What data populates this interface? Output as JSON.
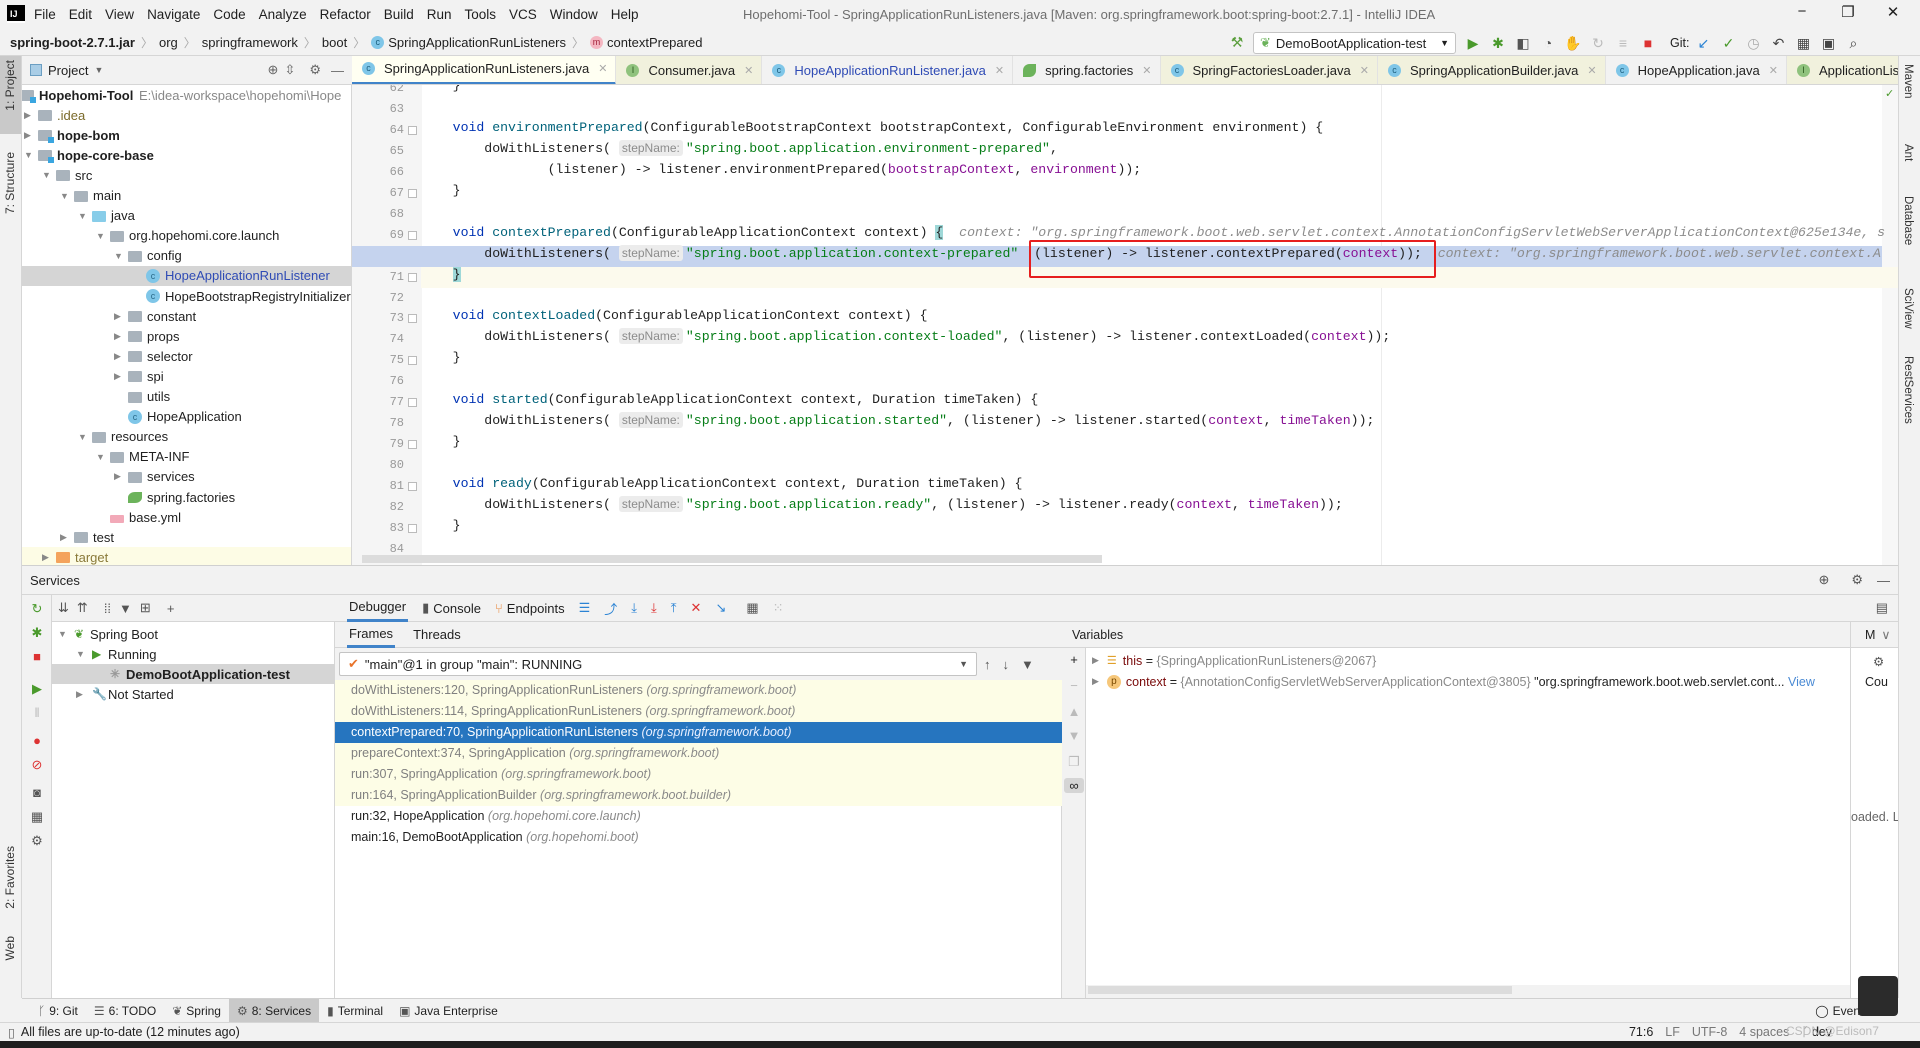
{
  "window": {
    "title": "Hopehomi-Tool - SpringApplicationRunListeners.java [Maven: org.springframework.boot:spring-boot:2.7.1] - IntelliJ IDEA",
    "logo": "IJ",
    "controls": {
      "minimize": "−",
      "restore": "❐",
      "close": "✕"
    }
  },
  "menu": [
    "File",
    "Edit",
    "View",
    "Navigate",
    "Code",
    "Analyze",
    "Refactor",
    "Build",
    "Run",
    "Tools",
    "VCS",
    "Window",
    "Help"
  ],
  "breadcrumb": [
    {
      "label": "spring-boot-2.7.1.jar",
      "bold": true,
      "icon": ""
    },
    {
      "label": "org",
      "icon": ""
    },
    {
      "label": "springframework",
      "icon": ""
    },
    {
      "label": "boot",
      "icon": ""
    },
    {
      "label": "SpringApplicationRunListeners",
      "icon": "class-icon"
    },
    {
      "label": "contextPrepared",
      "icon": "method-icon"
    }
  ],
  "toolbar": {
    "run_config": "DemoBootApplication-test",
    "git_label": "Git:"
  },
  "left_strip": [
    "1: Project",
    "7: Structure",
    "2: Favorites",
    "Web"
  ],
  "right_strip": [
    "Maven",
    "Ant",
    "Database",
    "SciView",
    "RestServices"
  ],
  "project": {
    "header": "Project",
    "root_path": "E:\\idea-workspace\\hopehomi\\Hope",
    "tree": [
      {
        "label": "Hopehomi-Tool",
        "level": 0,
        "arrow": "open",
        "icon": "module",
        "bold": true
      },
      {
        "label": ".idea",
        "level": 1,
        "arrow": "closed",
        "icon": "folder",
        "color": "#7a6a2a"
      },
      {
        "label": "hope-bom",
        "level": 1,
        "arrow": "closed",
        "icon": "module",
        "bold": true
      },
      {
        "label": "hope-core-base",
        "level": 1,
        "arrow": "open",
        "icon": "module",
        "bold": true
      },
      {
        "label": "src",
        "level": 2,
        "arrow": "open",
        "icon": "folder"
      },
      {
        "label": "main",
        "level": 3,
        "arrow": "open",
        "icon": "folder"
      },
      {
        "label": "java",
        "level": 4,
        "arrow": "open",
        "icon": "java"
      },
      {
        "label": "org.hopehomi.core.launch",
        "level": 5,
        "arrow": "open",
        "icon": "folder"
      },
      {
        "label": "config",
        "level": 6,
        "arrow": "open",
        "icon": "folder"
      },
      {
        "label": "HopeApplicationRunListener",
        "level": 7,
        "arrow": "",
        "icon": "cls",
        "selected": true,
        "color": "#2f4bb5"
      },
      {
        "label": "HopeBootstrapRegistryInitializer",
        "level": 7,
        "arrow": "",
        "icon": "cls"
      },
      {
        "label": "constant",
        "level": 6,
        "arrow": "closed",
        "icon": "folder"
      },
      {
        "label": "props",
        "level": 6,
        "arrow": "closed",
        "icon": "folder"
      },
      {
        "label": "selector",
        "level": 6,
        "arrow": "closed",
        "icon": "folder"
      },
      {
        "label": "spi",
        "level": 6,
        "arrow": "closed",
        "icon": "folder"
      },
      {
        "label": "utils",
        "level": 6,
        "arrow": "",
        "icon": "folder"
      },
      {
        "label": "HopeApplication",
        "level": 6,
        "arrow": "",
        "icon": "cls"
      },
      {
        "label": "resources",
        "level": 4,
        "arrow": "open",
        "icon": "folder"
      },
      {
        "label": "META-INF",
        "level": 5,
        "arrow": "open",
        "icon": "folder"
      },
      {
        "label": "services",
        "level": 6,
        "arrow": "closed",
        "icon": "folder"
      },
      {
        "label": "spring.factories",
        "level": 6,
        "arrow": "",
        "icon": "spring"
      },
      {
        "label": "base.yml",
        "level": 5,
        "arrow": "",
        "icon": "yml"
      },
      {
        "label": "test",
        "level": 3,
        "arrow": "closed",
        "icon": "folder"
      },
      {
        "label": "target",
        "level": 2,
        "arrow": "closed",
        "icon": "excl",
        "excluded": true,
        "color": "#8a7a3a"
      }
    ]
  },
  "tabs": [
    {
      "label": "SpringApplicationRunListeners.java",
      "icon": "class-icon",
      "active": true,
      "lib": true
    },
    {
      "label": "Consumer.java",
      "icon": "interface-icon",
      "lib": true
    },
    {
      "label": "HopeApplicationRunListener.java",
      "icon": "class-icon",
      "color": "#2f4bb5"
    },
    {
      "label": "spring.factories",
      "icon": "spring-icon"
    },
    {
      "label": "SpringFactoriesLoader.java",
      "icon": "class-icon",
      "lib": true
    },
    {
      "label": "SpringApplicationBuilder.java",
      "icon": "class-icon",
      "lib": true
    },
    {
      "label": "HopeApplication.java",
      "icon": "class-icon"
    },
    {
      "label": "ApplicationListene",
      "icon": "interface-icon",
      "lib": true,
      "noclose": true
    }
  ],
  "editor": {
    "exec_line": 70,
    "lines": [
      {
        "n": "62",
        "tokens": [
          [
            "p",
            "    }"
          ]
        ]
      },
      {
        "n": "63",
        "tokens": []
      },
      {
        "n": "64",
        "fold": true,
        "tokens": [
          [
            "p",
            "    "
          ],
          [
            "k",
            "void "
          ],
          [
            "f",
            "environmentPrepared"
          ],
          [
            "p",
            "(ConfigurableBootstrapContext bootstrapContext, ConfigurableEnvironment environment) {"
          ]
        ]
      },
      {
        "n": "65",
        "tokens": [
          [
            "p",
            "        doWithListeners( "
          ],
          [
            "h",
            "stepName:"
          ],
          [
            "s",
            "\"spring.boot.application.environment-prepared\""
          ],
          [
            "p",
            ","
          ]
        ]
      },
      {
        "n": "66",
        "tokens": [
          [
            "p",
            "                (listener) -> listener.environmentPrepared("
          ],
          [
            "v",
            "bootstrapContext"
          ],
          [
            "p",
            ", "
          ],
          [
            "v",
            "environment"
          ],
          [
            "p",
            "));"
          ]
        ]
      },
      {
        "n": "67",
        "fold": true,
        "tokens": [
          [
            "p",
            "    }"
          ]
        ]
      },
      {
        "n": "68",
        "tokens": []
      },
      {
        "n": "69",
        "fold": true,
        "tokens": [
          [
            "p",
            "    "
          ],
          [
            "k",
            "void "
          ],
          [
            "f",
            "contextPrepared"
          ],
          [
            "p",
            "(ConfigurableApplicationContext context) "
          ],
          [
            "b",
            "{"
          ],
          [
            "i",
            "  context: \"org.springframework.boot.web.servlet.context.AnnotationConfigServletWebServerApplicationContext@625e134e, s"
          ]
        ]
      },
      {
        "n": "70",
        "tokens": [
          [
            "p",
            "        doWithListeners( "
          ],
          [
            "h",
            "stepName:"
          ],
          [
            "s",
            "\"spring.boot.application.context-prepared\""
          ],
          [
            "p",
            "  (listener) -> listener.contextPrepared("
          ],
          [
            "v",
            "context"
          ],
          [
            "p",
            "));"
          ],
          [
            "i",
            "  context: \"org.springframework.boot.web.servlet.context.A"
          ]
        ]
      },
      {
        "n": "71",
        "fold": true,
        "cur": true,
        "tokens": [
          [
            "p",
            "    "
          ],
          [
            "b",
            "}"
          ]
        ]
      },
      {
        "n": "72",
        "tokens": []
      },
      {
        "n": "73",
        "fold": true,
        "tokens": [
          [
            "p",
            "    "
          ],
          [
            "k",
            "void "
          ],
          [
            "f",
            "contextLoaded"
          ],
          [
            "p",
            "(ConfigurableApplicationContext context) {"
          ]
        ]
      },
      {
        "n": "74",
        "tokens": [
          [
            "p",
            "        doWithListeners( "
          ],
          [
            "h",
            "stepName:"
          ],
          [
            "s",
            "\"spring.boot.application.context-loaded\""
          ],
          [
            "p",
            ", (listener) -> listener.contextLoaded("
          ],
          [
            "v",
            "context"
          ],
          [
            "p",
            "));"
          ]
        ]
      },
      {
        "n": "75",
        "fold": true,
        "tokens": [
          [
            "p",
            "    }"
          ]
        ]
      },
      {
        "n": "76",
        "tokens": []
      },
      {
        "n": "77",
        "fold": true,
        "tokens": [
          [
            "p",
            "    "
          ],
          [
            "k",
            "void "
          ],
          [
            "f",
            "started"
          ],
          [
            "p",
            "(ConfigurableApplicationContext context, Duration timeTaken) {"
          ]
        ]
      },
      {
        "n": "78",
        "tokens": [
          [
            "p",
            "        doWithListeners( "
          ],
          [
            "h",
            "stepName:"
          ],
          [
            "s",
            "\"spring.boot.application.started\""
          ],
          [
            "p",
            ", (listener) -> listener.started("
          ],
          [
            "v",
            "context"
          ],
          [
            "p",
            ", "
          ],
          [
            "v",
            "timeTaken"
          ],
          [
            "p",
            "));"
          ]
        ]
      },
      {
        "n": "79",
        "fold": true,
        "tokens": [
          [
            "p",
            "    }"
          ]
        ]
      },
      {
        "n": "80",
        "tokens": []
      },
      {
        "n": "81",
        "fold": true,
        "tokens": [
          [
            "p",
            "    "
          ],
          [
            "k",
            "void "
          ],
          [
            "f",
            "ready"
          ],
          [
            "p",
            "(ConfigurableApplicationContext context, Duration timeTaken) {"
          ]
        ]
      },
      {
        "n": "82",
        "tokens": [
          [
            "p",
            "        doWithListeners( "
          ],
          [
            "h",
            "stepName:"
          ],
          [
            "s",
            "\"spring.boot.application.ready\""
          ],
          [
            "p",
            ", (listener) -> listener.ready("
          ],
          [
            "v",
            "context"
          ],
          [
            "p",
            ", "
          ],
          [
            "v",
            "timeTaken"
          ],
          [
            "p",
            "));"
          ]
        ]
      },
      {
        "n": "83",
        "fold": true,
        "tokens": [
          [
            "p",
            "    }"
          ]
        ]
      },
      {
        "n": "84",
        "tokens": []
      }
    ]
  },
  "services": {
    "title": "Services",
    "tree": [
      {
        "label": "Spring Boot",
        "level": 0,
        "arrow": "open",
        "icon": "spring-boot-icon"
      },
      {
        "label": "Running",
        "level": 1,
        "arrow": "open",
        "icon": "run-icon"
      },
      {
        "label": "DemoBootApplication-test",
        "level": 2,
        "arrow": "",
        "icon": "spinner-icon",
        "selected": true
      },
      {
        "label": "Not Started",
        "level": 1,
        "arrow": "closed",
        "icon": "wrench-icon"
      }
    ]
  },
  "debugger": {
    "tabs": [
      "Debugger",
      "Console",
      "Endpoints"
    ],
    "subtabs": [
      "Frames",
      "Threads"
    ],
    "thread": "\"main\"@1 in group \"main\": RUNNING",
    "selected_frame": 2,
    "frames": [
      {
        "method": "doWithListeners:120, SpringApplicationRunListeners",
        "pkg": "(org.springframework.boot)",
        "lib": true
      },
      {
        "method": "doWithListeners:114, SpringApplicationRunListeners",
        "pkg": "(org.springframework.boot)",
        "lib": true
      },
      {
        "method": "contextPrepared:70, SpringApplicationRunListeners",
        "pkg": "(org.springframework.boot)",
        "lib": true
      },
      {
        "method": "prepareContext:374, SpringApplication",
        "pkg": "(org.springframework.boot)",
        "lib": true
      },
      {
        "method": "run:307, SpringApplication",
        "pkg": "(org.springframework.boot)",
        "lib": true
      },
      {
        "method": "run:164, SpringApplicationBuilder",
        "pkg": "(org.springframework.boot.builder)",
        "lib": true
      },
      {
        "method": "run:32, HopeApplication",
        "pkg": "(org.hopehomi.core.launch)",
        "lib": false
      },
      {
        "method": "main:16, DemoBootApplication",
        "pkg": "(org.hopehomi.boot)",
        "lib": false
      }
    ]
  },
  "variables": {
    "title": "Variables",
    "items": [
      {
        "name": "this",
        "eq": " = ",
        "value": "{SpringApplicationRunListeners@2067}",
        "extra": "",
        "link": "",
        "icon": "field-icon"
      },
      {
        "name": "context",
        "eq": " = ",
        "value": "{AnnotationConfigServletWebServerApplicationContext@3805}",
        "extra": " \"org.springframework.boot.web.servlet.cont...",
        "link": " View",
        "icon": "parameter-icon"
      }
    ]
  },
  "mini_panel": {
    "tab": "M",
    "col": "Cou",
    "note": "oaded. L"
  },
  "tool_buttons": [
    {
      "label": "9: Git",
      "icon": "git-icon"
    },
    {
      "label": "6: TODO",
      "icon": "todo-icon"
    },
    {
      "label": "Spring",
      "icon": "spring-icon"
    },
    {
      "label": "8: Services",
      "icon": "services-icon",
      "selected": true
    },
    {
      "label": "Terminal",
      "icon": "terminal-icon"
    },
    {
      "label": "Java Enterprise",
      "icon": "java-enterprise-icon"
    }
  ],
  "event_log": "Even",
  "status": {
    "message": "All files are up-to-date (12 minutes ago)",
    "position": "71:6",
    "line_sep": "LF",
    "encoding": "UTF-8",
    "indent": "4 spaces",
    "branch": "dev"
  },
  "watermark": "CSDN @Edison7",
  "colors": {
    "accent": "#4083c9",
    "selection": "#2675bf",
    "exec_line": "#c5d3ee",
    "red_box": "#e61e1e",
    "string": "#067d17",
    "keyword": "#0033b3"
  }
}
